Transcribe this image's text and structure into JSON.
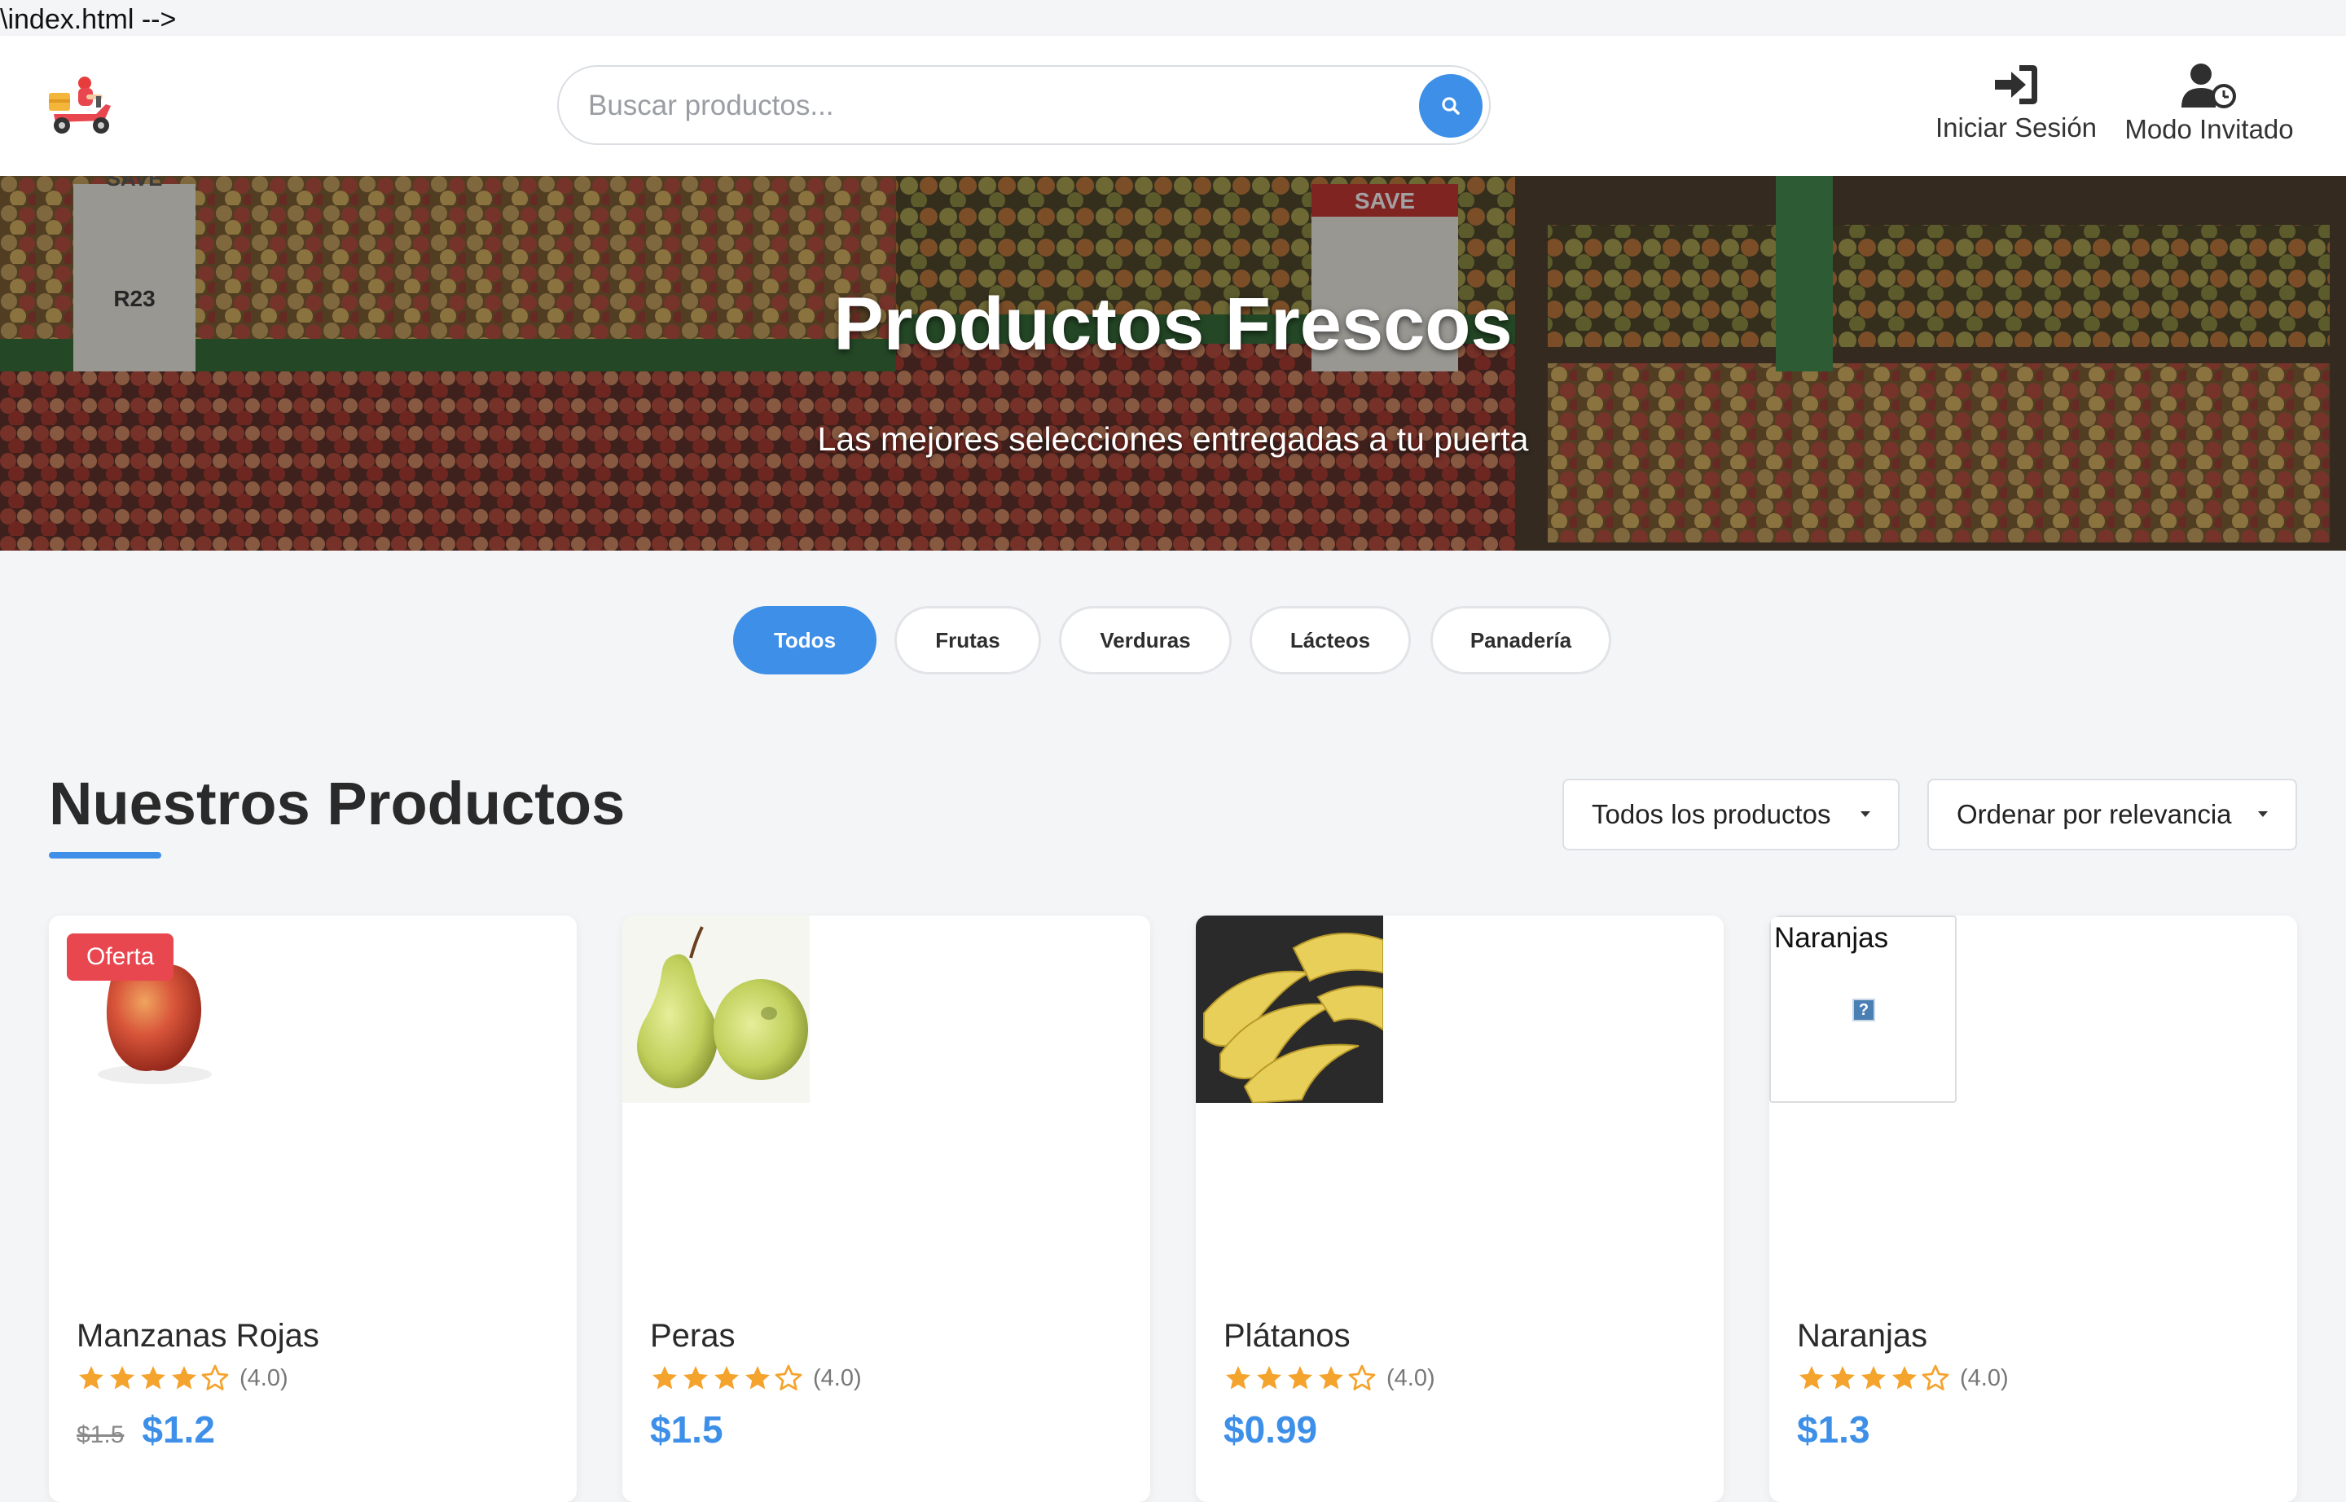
{
  "page_comment": "\\index.html -->",
  "header": {
    "search": {
      "placeholder": "Buscar productos...",
      "value": ""
    },
    "actions": [
      {
        "label": "Iniciar Sesión",
        "icon": "sign-in-icon"
      },
      {
        "label": "Modo Invitado",
        "icon": "user-clock-icon"
      }
    ]
  },
  "hero": {
    "title": "Productos Frescos",
    "subtitle": "Las mejores selecciones entregadas a tu puerta",
    "background_signs": [
      "SAVE",
      "SAVE",
      "R23"
    ]
  },
  "categories": [
    {
      "label": "Todos",
      "active": true
    },
    {
      "label": "Frutas",
      "active": false
    },
    {
      "label": "Verduras",
      "active": false
    },
    {
      "label": "Lácteos",
      "active": false
    },
    {
      "label": "Panadería",
      "active": false
    }
  ],
  "section": {
    "title": "Nuestros Productos",
    "filter_select": "Todos los productos",
    "sort_select": "Ordenar por relevancia"
  },
  "products": [
    {
      "name": "Manzanas Rojas",
      "badge": "Oferta",
      "rating": 4.0,
      "rating_text": "(4.0)",
      "old_price": "$1.5",
      "price": "$1.2",
      "image": "red-apple"
    },
    {
      "name": "Peras",
      "rating": 4.0,
      "rating_text": "(4.0)",
      "price": "$1.5",
      "image": "pears"
    },
    {
      "name": "Plátanos",
      "rating": 4.0,
      "rating_text": "(4.0)",
      "price": "$0.99",
      "image": "bananas"
    },
    {
      "name": "Naranjas",
      "rating": 4.0,
      "rating_text": "(4.0)",
      "price": "$1.3",
      "image": "broken-image",
      "image_alt": "Naranjas"
    }
  ],
  "colors": {
    "accent": "#3d8fe8",
    "badge": "#e8474f",
    "star": "#f4a32c",
    "background": "#f4f5f7"
  }
}
